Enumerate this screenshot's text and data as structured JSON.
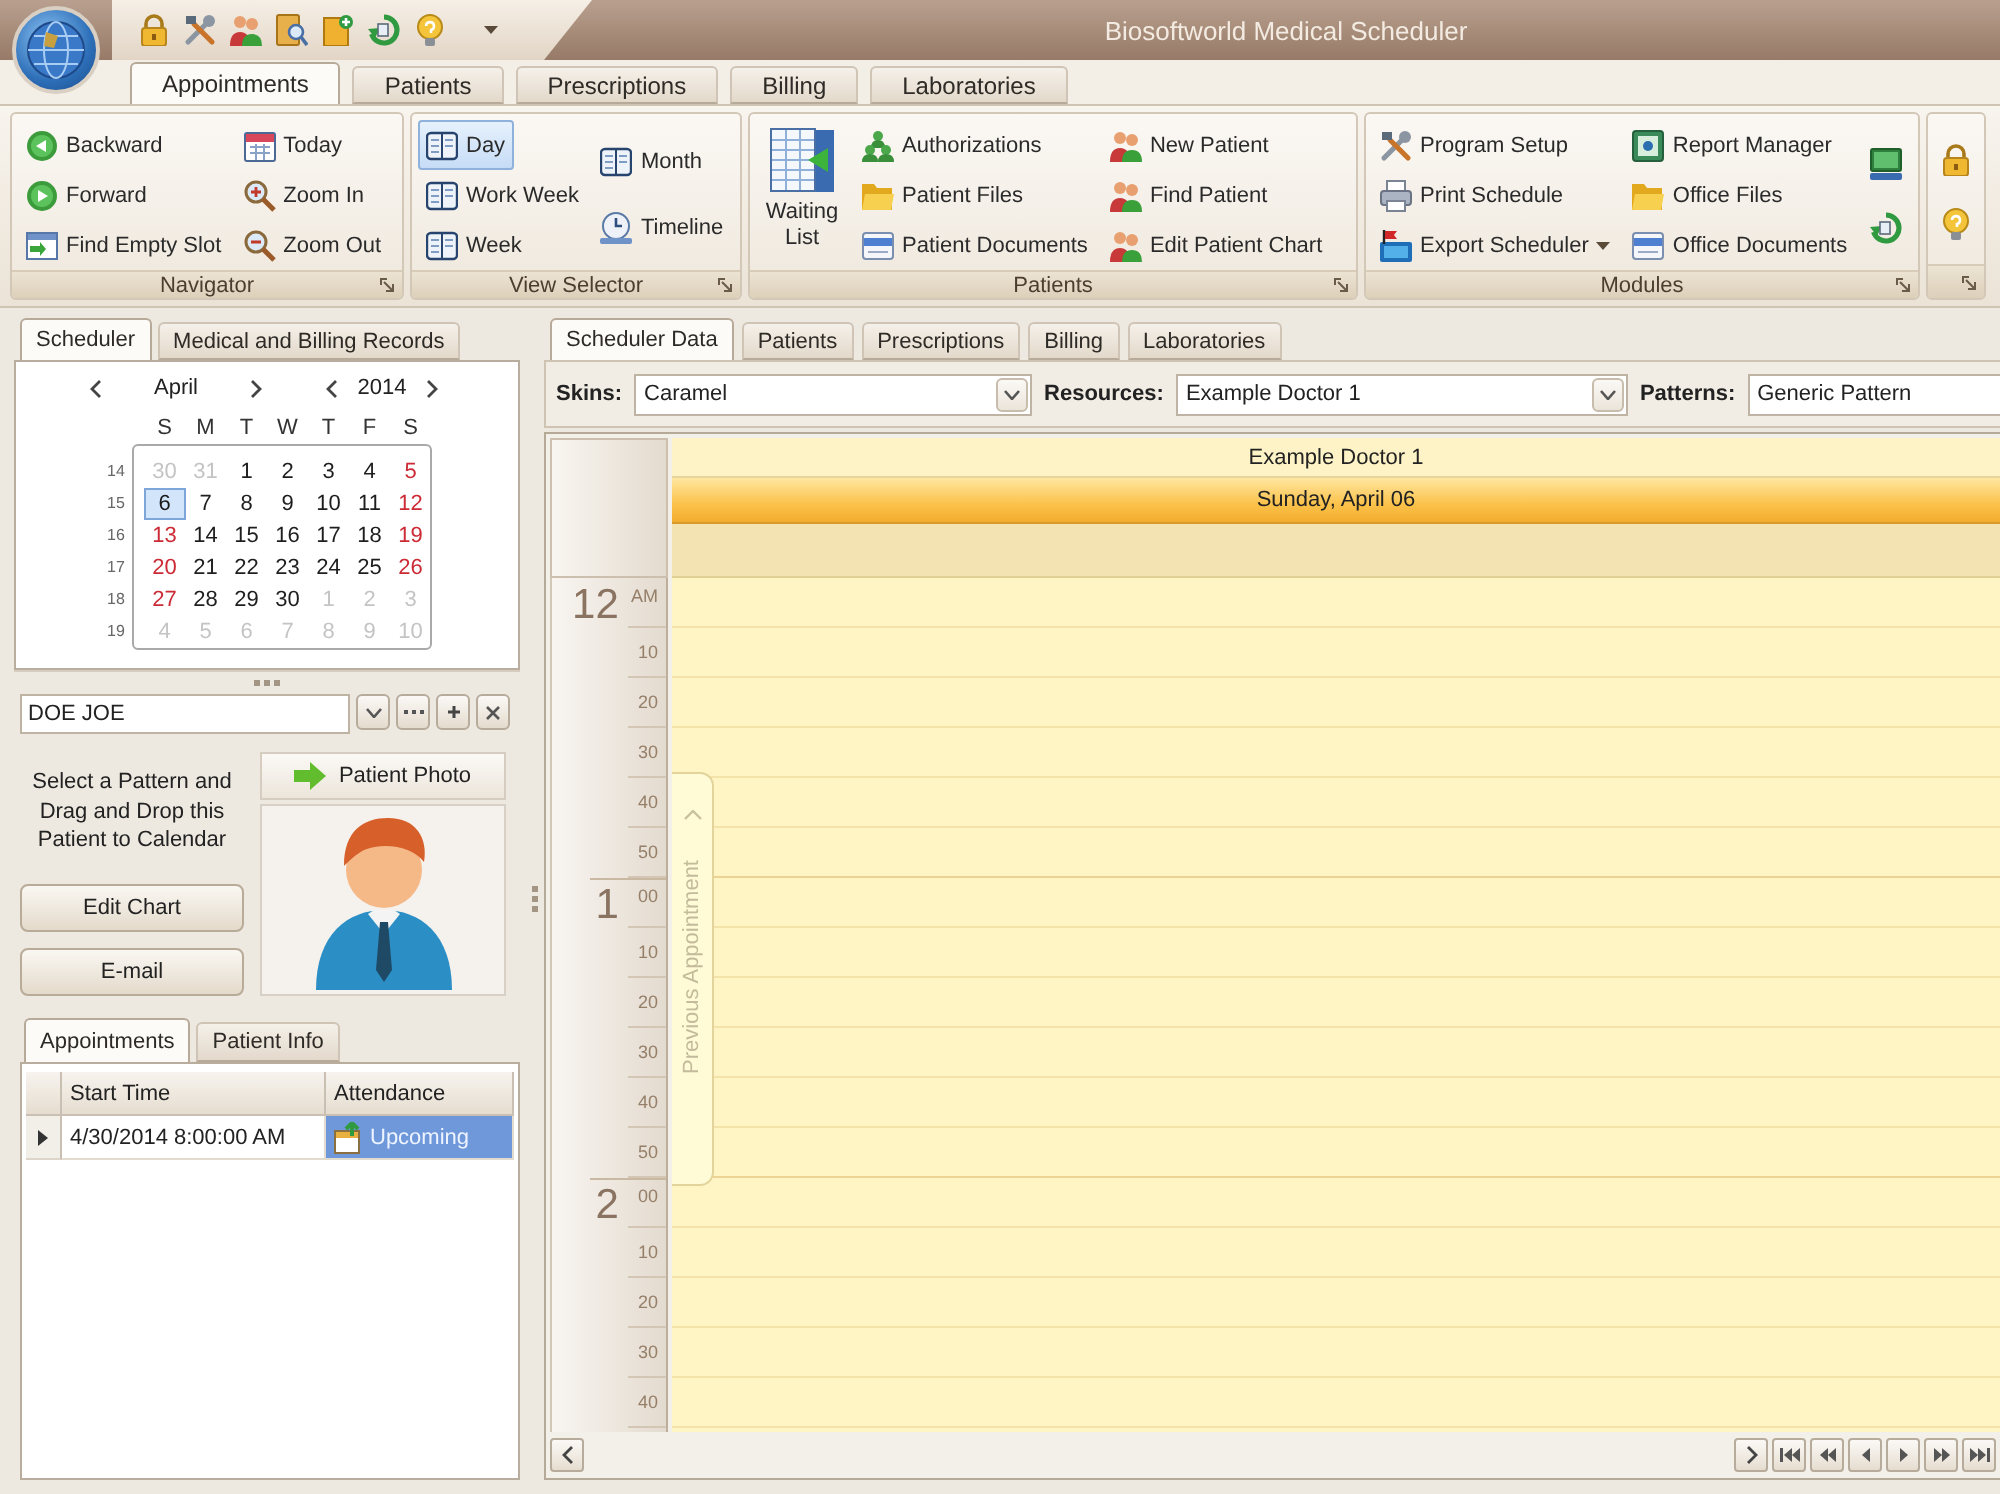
{
  "window": {
    "title": "Biosoftworld Medical Scheduler"
  },
  "ribbon_tabs": [
    {
      "label": "Appointments",
      "selected": true
    },
    {
      "label": "Patients",
      "selected": false
    },
    {
      "label": "Prescriptions",
      "selected": false
    },
    {
      "label": "Billing",
      "selected": false
    },
    {
      "label": "Laboratories",
      "selected": false
    }
  ],
  "ribbon_groups": [
    {
      "kind": "buttons",
      "label": "Navigator",
      "columns": [
        [
          {
            "label": "Backward"
          },
          {
            "label": "Forward"
          },
          {
            "label": "Find Empty Slot"
          }
        ],
        [
          {
            "label": "Today"
          },
          {
            "label": "Zoom In"
          },
          {
            "label": "Zoom Out"
          }
        ]
      ]
    },
    {
      "kind": "views",
      "label": "View Selector",
      "columns": [
        [
          {
            "label": "Day",
            "selected": true
          },
          {
            "label": "Work Week",
            "selected": false
          },
          {
            "label": "Week",
            "selected": false
          }
        ],
        [
          {
            "label": "Month",
            "selected": false
          },
          {
            "label": "Timeline",
            "selected": false
          }
        ]
      ]
    },
    {
      "kind": "large_and_buttons",
      "label": "Patients",
      "large_button": "Waiting List",
      "columns": [
        [
          {
            "label": "Authorizations"
          },
          {
            "label": "Patient Files"
          },
          {
            "label": "Patient Documents"
          }
        ],
        [
          {
            "label": "New Patient"
          },
          {
            "label": "Find Patient"
          },
          {
            "label": "Edit Patient Chart"
          }
        ]
      ]
    },
    {
      "kind": "buttons_and_icons",
      "label": "Modules",
      "columns": [
        [
          {
            "label": "Program Setup",
            "dropdown": false
          },
          {
            "label": "Print Schedule",
            "dropdown": false
          },
          {
            "label": "Export Scheduler",
            "dropdown": true
          }
        ],
        [
          {
            "label": "Report Manager",
            "dropdown": false
          },
          {
            "label": "Office Files",
            "dropdown": false
          },
          {
            "label": "Office Documents",
            "dropdown": false
          }
        ]
      ]
    },
    {
      "kind": "icons"
    }
  ],
  "left_tabs": [
    {
      "label": "Scheduler",
      "selected": true
    },
    {
      "label": "Medical and Billing Records",
      "selected": false
    }
  ],
  "calendar": {
    "month": "April",
    "year": "2014",
    "day_names": [
      "S",
      "M",
      "T",
      "W",
      "T",
      "F",
      "S"
    ],
    "weeks": [
      {
        "number": "14",
        "days": [
          {
            "label": "30",
            "other_month": true,
            "selected": false
          },
          {
            "label": "31",
            "other_month": true,
            "selected": false
          },
          {
            "label": "1",
            "other_month": false,
            "selected": false
          },
          {
            "label": "2",
            "other_month": false,
            "selected": false
          },
          {
            "label": "3",
            "other_month": false,
            "selected": false
          },
          {
            "label": "4",
            "other_month": false,
            "selected": false
          },
          {
            "label": "5",
            "other_month": false,
            "selected": false
          }
        ]
      },
      {
        "number": "15",
        "days": [
          {
            "label": "6",
            "other_month": false,
            "selected": true
          },
          {
            "label": "7",
            "other_month": false,
            "selected": false
          },
          {
            "label": "8",
            "other_month": false,
            "selected": false
          },
          {
            "label": "9",
            "other_month": false,
            "selected": false
          },
          {
            "label": "10",
            "other_month": false,
            "selected": false
          },
          {
            "label": "11",
            "other_month": false,
            "selected": false
          },
          {
            "label": "12",
            "other_month": false,
            "selected": false
          }
        ]
      },
      {
        "number": "16",
        "days": [
          {
            "label": "13",
            "other_month": false,
            "selected": false
          },
          {
            "label": "14",
            "other_month": false,
            "selected": false
          },
          {
            "label": "15",
            "other_month": false,
            "selected": false
          },
          {
            "label": "16",
            "other_month": false,
            "selected": false
          },
          {
            "label": "17",
            "other_month": false,
            "selected": false
          },
          {
            "label": "18",
            "other_month": false,
            "selected": false
          },
          {
            "label": "19",
            "other_month": false,
            "selected": false
          }
        ]
      },
      {
        "number": "17",
        "days": [
          {
            "label": "20",
            "other_month": false,
            "selected": false
          },
          {
            "label": "21",
            "other_month": false,
            "selected": false
          },
          {
            "label": "22",
            "other_month": false,
            "selected": false
          },
          {
            "label": "23",
            "other_month": false,
            "selected": false
          },
          {
            "label": "24",
            "other_month": false,
            "selected": false
          },
          {
            "label": "25",
            "other_month": false,
            "selected": false
          },
          {
            "label": "26",
            "other_month": false,
            "selected": false
          }
        ]
      },
      {
        "number": "18",
        "days": [
          {
            "label": "27",
            "other_month": false,
            "selected": false
          },
          {
            "label": "28",
            "other_month": false,
            "selected": false
          },
          {
            "label": "29",
            "other_month": false,
            "selected": false
          },
          {
            "label": "30",
            "other_month": false,
            "selected": false
          },
          {
            "label": "1",
            "other_month": true,
            "selected": false
          },
          {
            "label": "2",
            "other_month": true,
            "selected": false
          },
          {
            "label": "3",
            "other_month": true,
            "selected": false
          }
        ]
      },
      {
        "number": "19",
        "days": [
          {
            "label": "4",
            "other_month": true,
            "selected": false
          },
          {
            "label": "5",
            "other_month": true,
            "selected": false
          },
          {
            "label": "6",
            "other_month": true,
            "selected": false
          },
          {
            "label": "7",
            "other_month": true,
            "selected": false
          },
          {
            "label": "8",
            "other_month": true,
            "selected": false
          },
          {
            "label": "9",
            "other_month": true,
            "selected": false
          },
          {
            "label": "10",
            "other_month": true,
            "selected": false
          }
        ]
      }
    ]
  },
  "patient": {
    "name": "DOE JOE",
    "instructions": "Select a Pattern and Drag and Drop this Patient to Calendar",
    "photo_button": "Patient Photo",
    "buttons": [
      "Edit Chart",
      "E-mail"
    ]
  },
  "patient_tabs": [
    {
      "label": "Appointments",
      "selected": true
    },
    {
      "label": "Patient Info",
      "selected": false
    }
  ],
  "appointments_table": {
    "columns": [
      "Start Time",
      "Attendance"
    ],
    "rows": [
      {
        "start_time": "4/30/2014 8:00:00 AM",
        "attendance": "Upcoming",
        "selected": true
      }
    ]
  },
  "scheduler_tabs": [
    {
      "label": "Scheduler Data",
      "selected": true
    },
    {
      "label": "Patients",
      "selected": false
    },
    {
      "label": "Prescriptions",
      "selected": false
    },
    {
      "label": "Billing",
      "selected": false
    },
    {
      "label": "Laboratories",
      "selected": false
    }
  ],
  "filters": [
    {
      "label": "Skins:",
      "value": "Caramel",
      "cut_off": false
    },
    {
      "label": "Resources:",
      "value": "Example Doctor 1",
      "cut_off": false
    },
    {
      "label": "Patterns:",
      "value": "Generic Pattern",
      "cut_off": true
    }
  ],
  "scheduler": {
    "resource": "Example Doctor 1",
    "date": "Sunday, April 06",
    "hours": [
      {
        "hour": "12",
        "suffix": "AM",
        "minutes": [
          "10",
          "20",
          "30",
          "40",
          "50"
        ]
      },
      {
        "hour": "1",
        "suffix": "00",
        "minutes": [
          "10",
          "20",
          "30",
          "40",
          "50"
        ]
      },
      {
        "hour": "2",
        "suffix": "00",
        "minutes": [
          "10",
          "20",
          "30",
          "40"
        ]
      }
    ],
    "previous_appointment": "Previous Appointment"
  }
}
